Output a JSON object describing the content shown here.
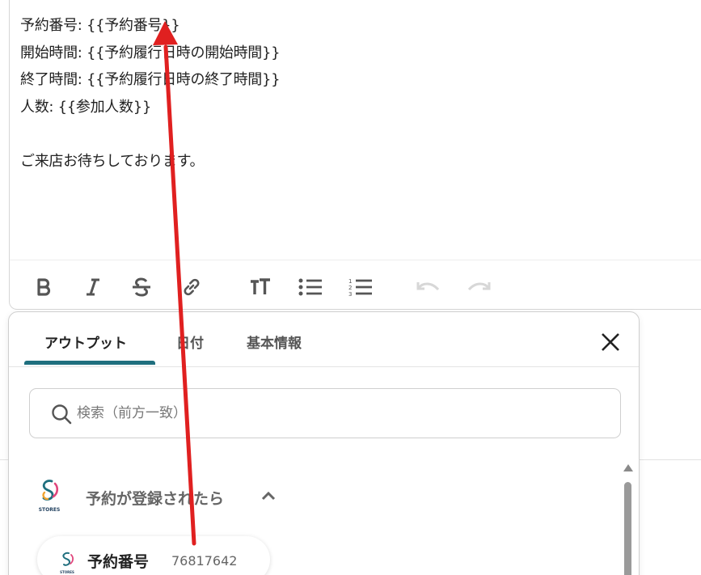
{
  "editor": {
    "lines": [
      "予約番号: {{予約番号}}",
      "開始時間: {{予約履行日時の開始時間}}",
      "終了時間: {{予約履行日時の終了時間}}",
      "人数: {{参加人数}}",
      "",
      "ご来店お待ちしております。"
    ],
    "toolbar": [
      "bold-icon",
      "italic-icon",
      "strikethrough-icon",
      "link-icon",
      "text-size-icon",
      "bullet-list-icon",
      "numbered-list-icon",
      "undo-icon",
      "redo-icon"
    ]
  },
  "panel": {
    "tabs": [
      {
        "label": "アウトプット",
        "active": true
      },
      {
        "label": "日付",
        "active": false
      },
      {
        "label": "基本情報",
        "active": false
      }
    ],
    "search": {
      "placeholder": "検索（前方一致）"
    },
    "section": {
      "title": "予約が登録されたら",
      "logo_text": "STORES"
    },
    "items": [
      {
        "label": "予約番号",
        "value": "76817642"
      }
    ]
  },
  "colors": {
    "accent": "#1f6f7e",
    "annotation": "#e02020"
  }
}
